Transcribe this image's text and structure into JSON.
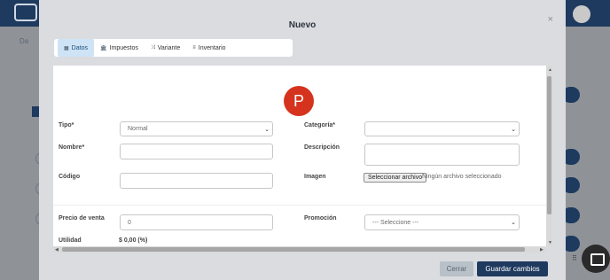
{
  "background": {
    "breadcrumb": "Da",
    "side_label": "Se"
  },
  "modal": {
    "title": "Nuevo",
    "close": "×"
  },
  "tabs": [
    {
      "label": "Datos",
      "icon": "id-card-icon",
      "glyph": "▦"
    },
    {
      "label": "Impuestos",
      "icon": "bank-icon",
      "glyph": "🏛"
    },
    {
      "label": "Variante",
      "icon": "shuffle-icon",
      "glyph": "⤨"
    },
    {
      "label": "Inventario",
      "icon": "list-icon",
      "glyph": "≡"
    }
  ],
  "form": {
    "avatar_letter": "P",
    "tipo": {
      "label": "Tipo*",
      "value": "Normal"
    },
    "categoria": {
      "label": "Categoría*",
      "value": ""
    },
    "nombre": {
      "label": "Nombre*",
      "value": ""
    },
    "descripcion": {
      "label": "Descripción",
      "value": ""
    },
    "codigo": {
      "label": "Código",
      "value": ""
    },
    "imagen": {
      "label": "Imagen",
      "button": "Seleccionar archivo",
      "status": "Ningún archivo seleccionado"
    },
    "precio_venta": {
      "label": "Precio de venta",
      "placeholder": "0"
    },
    "promocion": {
      "label": "Promoción",
      "value": "--- Seleccione ---"
    },
    "utilidad": {
      "label": "Utilidad",
      "value": "$ 0,00 (%)"
    }
  },
  "footer": {
    "cancel": "Cerrar",
    "save": "Guardar cambios"
  },
  "colors": {
    "primary": "#1e3a5f",
    "avatar": "#d6331f",
    "tab_active": "#cfe3f6"
  }
}
